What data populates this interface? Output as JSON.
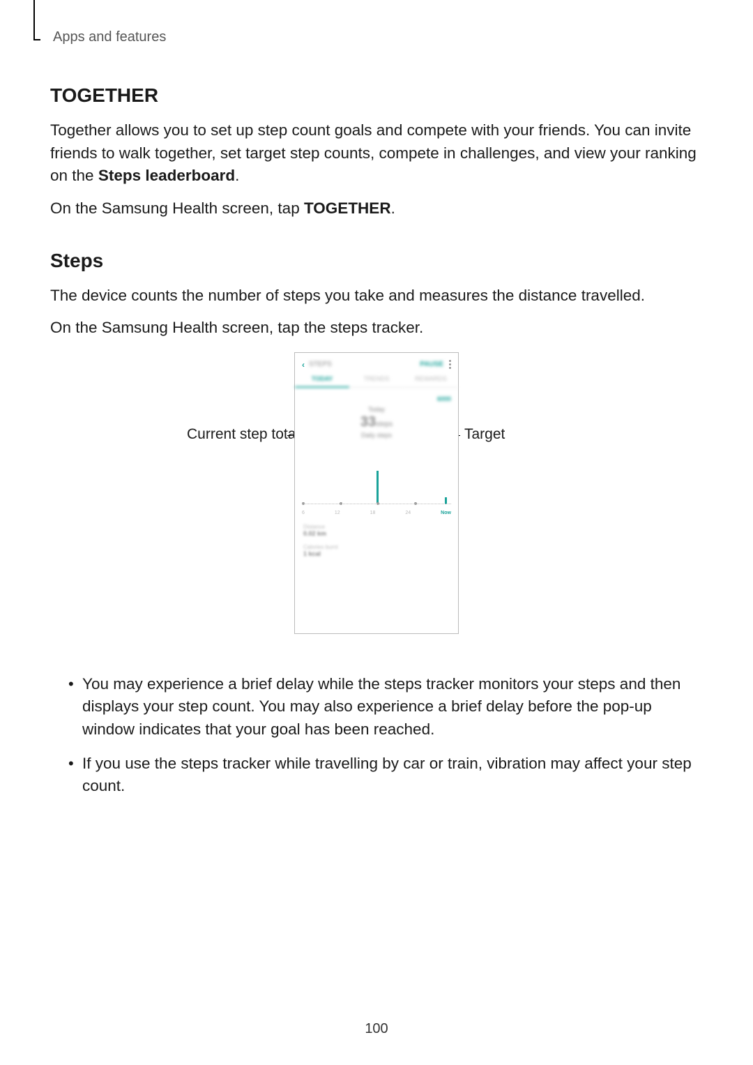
{
  "running_head": "Apps and features",
  "section1": {
    "title": "TOGETHER",
    "para_pre": "Together allows you to set up step count goals and compete with your friends. You can invite friends to walk together, set target step counts, compete in challenges, and view your ranking on the ",
    "para_bold": "Steps leaderboard",
    "para_post": ".",
    "instr_pre": "On the Samsung Health screen, tap ",
    "instr_bold": "TOGETHER",
    "instr_post": "."
  },
  "section2": {
    "title": "Steps",
    "para": "The device counts the number of steps you take and measures the distance travelled.",
    "instr": "On the Samsung Health screen, tap the steps tracker."
  },
  "callouts": {
    "left": "Current step total",
    "right": "Target"
  },
  "phone": {
    "header_title": "STEPS",
    "header_right": "PAUSE",
    "tabs": [
      "TODAY",
      "TRENDS",
      "REWARDS"
    ],
    "target_label": "6000",
    "today_label": "Today",
    "big_value": "33",
    "big_unit": "steps",
    "sub_label": "Daily steps",
    "ticks": [
      "6",
      "12",
      "18",
      "24",
      "Now"
    ],
    "stat1_label": "Distance",
    "stat1_value": "0.02 km",
    "stat2_label": "Calories burnt",
    "stat2_value": "1 kcal"
  },
  "notes": {
    "item1": "You may experience a brief delay while the steps tracker monitors your steps and then displays your step count. You may also experience a brief delay before the pop-up window indicates that your goal has been reached.",
    "item2": "If you use the steps tracker while travelling by car or train, vibration may affect your step count."
  },
  "page_number": "100"
}
